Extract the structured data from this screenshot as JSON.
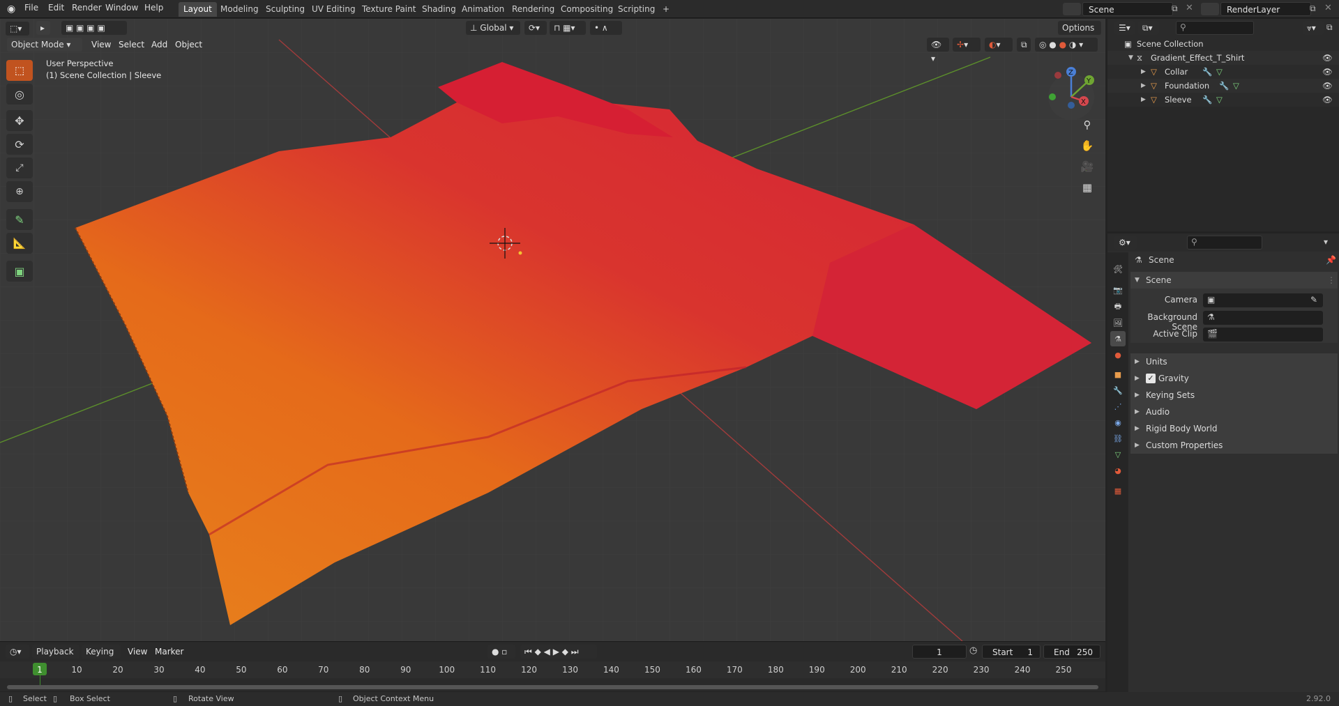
{
  "top_menu": {
    "items": [
      "File",
      "Edit",
      "Render",
      "Window",
      "Help"
    ],
    "workspaces": [
      "Layout",
      "Modeling",
      "Sculpting",
      "UV Editing",
      "Texture Paint",
      "Shading",
      "Animation",
      "Rendering",
      "Compositing",
      "Scripting"
    ],
    "add_tab": "+",
    "scene_name": "Scene",
    "view_layer": "RenderLayer"
  },
  "viewport": {
    "mode": "Object Mode",
    "menus": [
      "View",
      "Select",
      "Add",
      "Object"
    ],
    "orientation": "Global",
    "options_label": "Options",
    "perspective_label": "User Perspective",
    "collection_label": "(1) Scene Collection | Sleeve",
    "gizmo_axes": [
      "Z",
      "Y",
      "X"
    ]
  },
  "timeline": {
    "menus": [
      "Playback",
      "Keying",
      "View",
      "Marker"
    ],
    "current_frame": "1",
    "start_label": "Start",
    "start_value": "1",
    "end_label": "End",
    "end_value": "250",
    "ticks": [
      "1",
      "10",
      "20",
      "30",
      "40",
      "50",
      "60",
      "70",
      "80",
      "90",
      "100",
      "110",
      "120",
      "130",
      "140",
      "150",
      "160",
      "170",
      "180",
      "190",
      "200",
      "210",
      "220",
      "230",
      "240",
      "250"
    ]
  },
  "status_bar": {
    "select": "Select",
    "box_select": "Box Select",
    "rotate_view": "Rotate View",
    "context_menu": "Object Context Menu",
    "version": "2.92.0"
  },
  "outliner": {
    "root": "Scene Collection",
    "collection": "Gradient_Effect_T_Shirt",
    "objects": [
      "Collar",
      "Foundation",
      "Sleeve"
    ]
  },
  "properties": {
    "context": "Scene",
    "panel_title": "Scene",
    "fields": [
      {
        "label": "Camera"
      },
      {
        "label": "Background Scene"
      },
      {
        "label": "Active Clip"
      }
    ],
    "subpanels": [
      "Units",
      "Gravity",
      "Keying Sets",
      "Audio",
      "Rigid Body World",
      "Custom Properties"
    ],
    "gravity_checked": true
  },
  "colors": {
    "accent": "#c1531f",
    "shirt_red": "#d8283a",
    "shirt_orange": "#e8741a",
    "active_frame": "#3f8f2f"
  }
}
